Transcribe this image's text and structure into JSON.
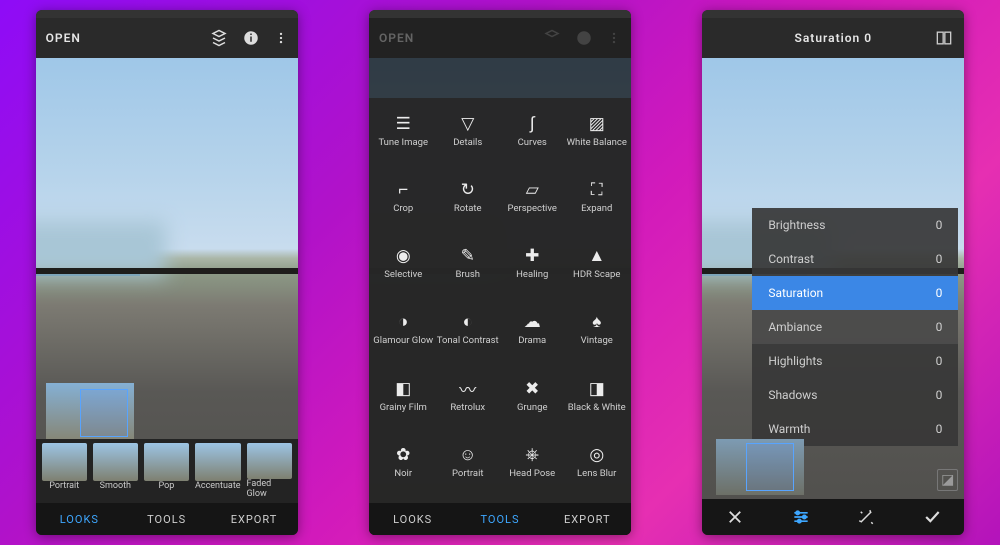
{
  "screens": {
    "s1": {
      "open": "OPEN",
      "tabs": {
        "looks": "LOOKS",
        "tools": "TOOLS",
        "export": "EXPORT",
        "active": "looks"
      },
      "looks": [
        {
          "label": "Portrait"
        },
        {
          "label": "Smooth"
        },
        {
          "label": "Pop"
        },
        {
          "label": "Accentuate"
        },
        {
          "label": "Faded Glow"
        }
      ],
      "icons": {
        "stack": "stack-icon",
        "info": "info-icon",
        "more": "more-icon"
      }
    },
    "s2": {
      "open": "OPEN",
      "tabs": {
        "looks": "LOOKS",
        "tools": "TOOLS",
        "export": "EXPORT",
        "active": "tools"
      },
      "tools": [
        {
          "label": "Tune Image",
          "glyph": "☰",
          "icon": "tune-icon"
        },
        {
          "label": "Details",
          "glyph": "▽",
          "icon": "details-icon"
        },
        {
          "label": "Curves",
          "glyph": "∫",
          "icon": "curves-icon"
        },
        {
          "label": "White Balance",
          "glyph": "▨",
          "icon": "white-balance-icon"
        },
        {
          "label": "Crop",
          "glyph": "⌐",
          "icon": "crop-icon"
        },
        {
          "label": "Rotate",
          "glyph": "↻",
          "icon": "rotate-icon"
        },
        {
          "label": "Perspective",
          "glyph": "▱",
          "icon": "perspective-icon"
        },
        {
          "label": "Expand",
          "glyph": "⛶",
          "icon": "expand-icon"
        },
        {
          "label": "Selective",
          "glyph": "◉",
          "icon": "selective-icon"
        },
        {
          "label": "Brush",
          "glyph": "✎",
          "icon": "brush-icon"
        },
        {
          "label": "Healing",
          "glyph": "✚",
          "icon": "healing-icon"
        },
        {
          "label": "HDR Scape",
          "glyph": "▲",
          "icon": "hdr-icon"
        },
        {
          "label": "Glamour Glow",
          "glyph": "◑",
          "icon": "glow-icon"
        },
        {
          "label": "Tonal Contrast",
          "glyph": "◐",
          "icon": "tonal-icon"
        },
        {
          "label": "Drama",
          "glyph": "☁",
          "icon": "drama-icon"
        },
        {
          "label": "Vintage",
          "glyph": "♠",
          "icon": "vintage-icon"
        },
        {
          "label": "Grainy Film",
          "glyph": "◧",
          "icon": "grainy-icon"
        },
        {
          "label": "Retrolux",
          "glyph": "〰",
          "icon": "retrolux-icon"
        },
        {
          "label": "Grunge",
          "glyph": "✖",
          "icon": "grunge-icon"
        },
        {
          "label": "Black & White",
          "glyph": "◨",
          "icon": "bw-icon"
        },
        {
          "label": "Noir",
          "glyph": "✿",
          "icon": "noir-icon"
        },
        {
          "label": "Portrait",
          "glyph": "☺",
          "icon": "portrait-icon"
        },
        {
          "label": "Head Pose",
          "glyph": "⎈",
          "icon": "headpose-icon"
        },
        {
          "label": "Lens Blur",
          "glyph": "◎",
          "icon": "lensblur-icon"
        }
      ]
    },
    "s3": {
      "title": "Saturation 0",
      "compare_icon": "compare-icon",
      "params": [
        {
          "name": "Brightness",
          "value": "0"
        },
        {
          "name": "Contrast",
          "value": "0"
        },
        {
          "name": "Saturation",
          "value": "0",
          "selected": true
        },
        {
          "name": "Ambiance",
          "value": "0",
          "sub": true
        },
        {
          "name": "Highlights",
          "value": "0"
        },
        {
          "name": "Shadows",
          "value": "0"
        },
        {
          "name": "Warmth",
          "value": "0"
        }
      ],
      "bottom": {
        "close": "close-icon",
        "adjust": "adjust-icon",
        "wand": "wand-icon",
        "apply": "check-icon"
      }
    }
  }
}
